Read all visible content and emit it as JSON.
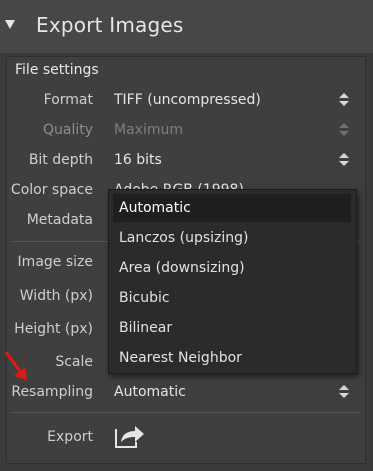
{
  "header": {
    "title": "Export Images"
  },
  "file_settings": {
    "title": "File settings",
    "format": {
      "label": "Format",
      "value": "TIFF (uncompressed)"
    },
    "quality": {
      "label": "Quality",
      "value": "Maximum"
    },
    "bit_depth": {
      "label": "Bit depth",
      "value": "16 bits"
    },
    "color_space": {
      "label": "Color space",
      "value": "Adobe RGB (1998)"
    },
    "metadata": {
      "label": "Metadata"
    }
  },
  "image_size": {
    "title": "Image size",
    "width": {
      "label": "Width (px)"
    },
    "height": {
      "label": "Height (px)"
    },
    "scale": {
      "label": "Scale"
    },
    "resampling": {
      "label": "Resampling",
      "value": "Automatic"
    }
  },
  "resampling_dropdown": {
    "options": [
      "Automatic",
      "Lanczos (upsizing)",
      "Area (downsizing)",
      "Bicubic",
      "Bilinear",
      "Nearest Neighbor"
    ],
    "selected": "Automatic"
  },
  "export": {
    "label": "Export"
  },
  "annotation": {
    "arrow_color": "#e01818"
  }
}
